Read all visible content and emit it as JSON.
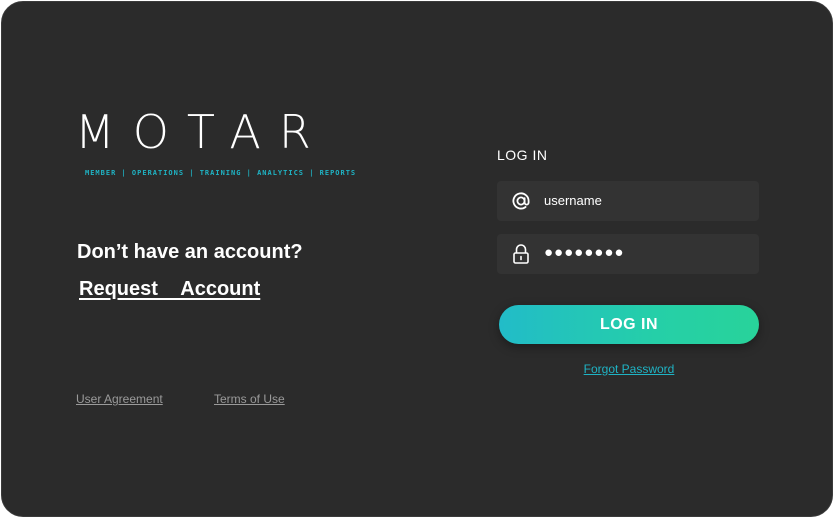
{
  "brand": {
    "logo": "MOTAR",
    "tagline": "MEMBER | OPERATIONS | TRAINING | ANALYTICS | REPORTS",
    "accent_color": "#1fb3c4"
  },
  "signup": {
    "prompt": "Don’t have an account?",
    "request_link": "Request  Account"
  },
  "footer": {
    "user_agreement": "User Agreement",
    "terms_of_use": "Terms of Use"
  },
  "login": {
    "heading": "LOG IN",
    "username": {
      "icon": "at-sign-icon",
      "value": "username"
    },
    "password": {
      "icon": "lock-icon",
      "masked_value": "●●●●●●●●"
    },
    "submit_label": "LOG IN",
    "submit_gradient": [
      "#22bcc8",
      "#28d39a"
    ],
    "forgot_link": "Forgot Password"
  }
}
